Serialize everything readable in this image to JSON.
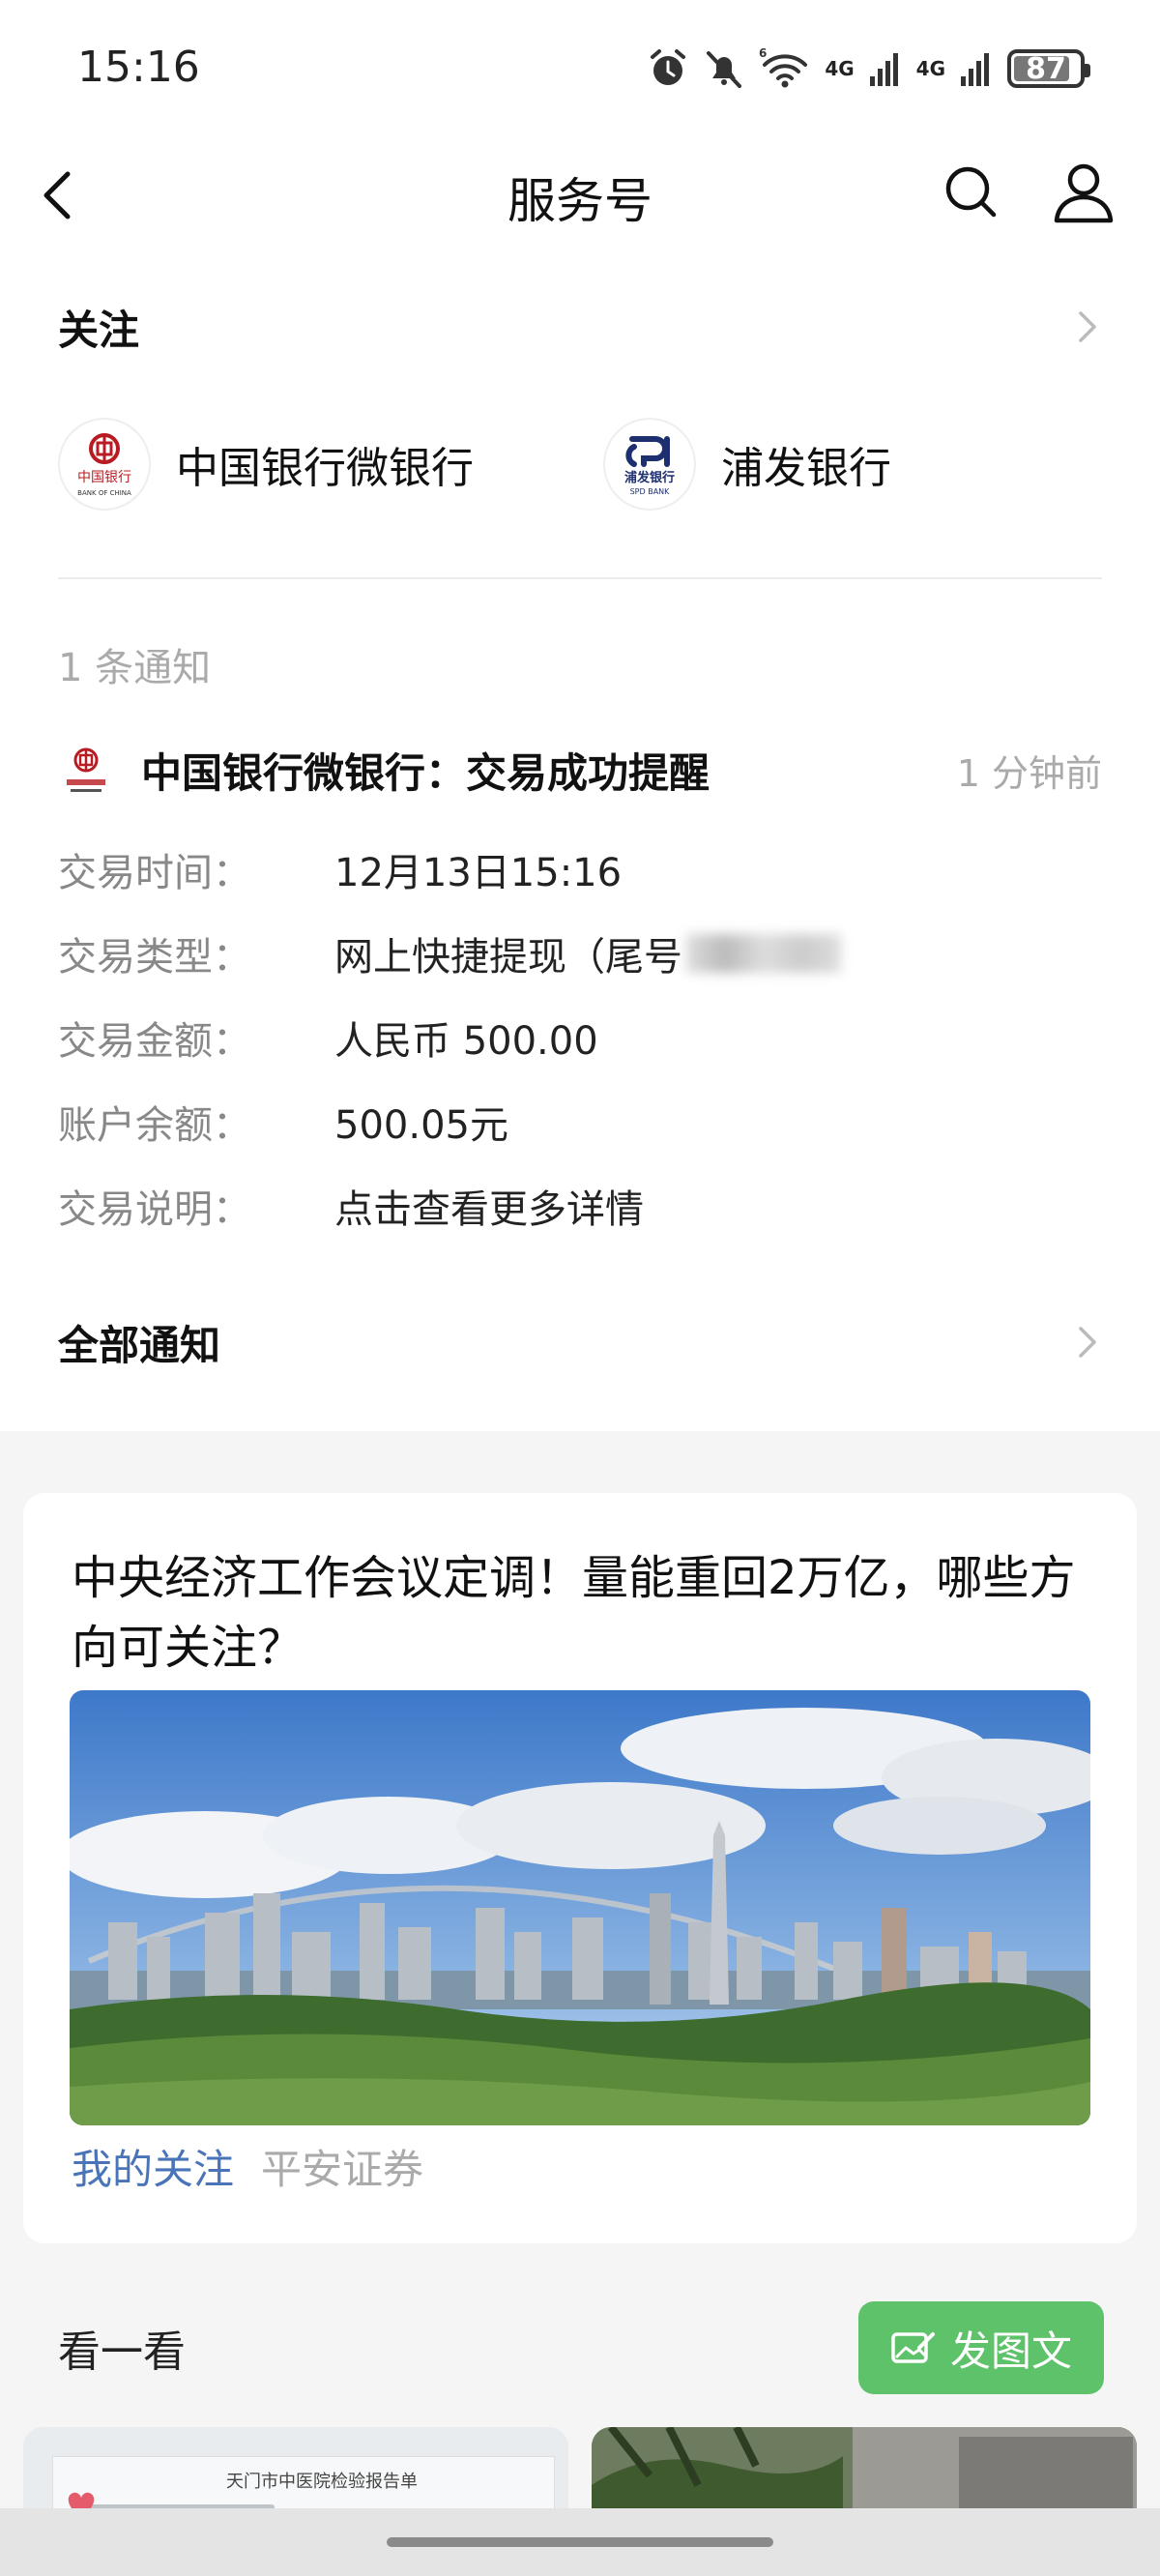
{
  "status_bar": {
    "time": "15:16",
    "net_a": "4G",
    "net_b": "4G",
    "battery_level": 87,
    "battery_text": "87",
    "icons": [
      "alarm-icon",
      "mute-icon",
      "wifi-icon",
      "signal-icon",
      "signal-icon",
      "battery-icon"
    ]
  },
  "nav": {
    "title": "服务号",
    "back_icon": "chevron-left-icon",
    "search_icon": "search-icon",
    "user_icon": "person-icon"
  },
  "followed": {
    "title": "关注",
    "items": [
      {
        "name": "中国银行微银行",
        "logo": "boc-logo",
        "logo_text": "中国银行",
        "logo_sub": "BANK OF CHINA"
      },
      {
        "name": "浦发银行",
        "logo": "spdb-logo",
        "logo_text": "浦发银行",
        "logo_sub": "SPD BANK"
      }
    ]
  },
  "notification": {
    "count_text": "1 条通知",
    "title": "中国银行微银行：交易成功提醒",
    "time": "1 分钟前",
    "rows": [
      {
        "key": "交易时间：",
        "value": "12月13日15:16"
      },
      {
        "key": "交易类型：",
        "value": "网上快捷提现（尾号"
      },
      {
        "key": "交易金额：",
        "value": "人民币 500.00"
      },
      {
        "key": "账户余额：",
        "value": "500.05元"
      },
      {
        "key": "交易说明：",
        "value": "点击查看更多详情"
      }
    ],
    "all_label": "全部通知"
  },
  "article": {
    "title": "中央经济工作会议定调！量能重回2万亿，哪些方向可关注？",
    "tag_follow": "我的关注",
    "tag_source": "平安证券"
  },
  "look": {
    "title": "看一看",
    "post_label": "发图文",
    "thumb_1_text": "天门市中医院检验报告单"
  },
  "colors": {
    "accent_green": "#5ec26a",
    "link_blue": "#4a74b8",
    "muted": "#aaaaaa",
    "boc_red": "#b81c22",
    "spdb_navy": "#1d2f6f"
  }
}
